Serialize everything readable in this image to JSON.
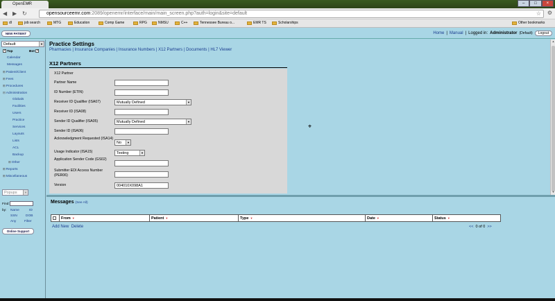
{
  "browser": {
    "tab_title": "OpenEMR",
    "tab_close": "×",
    "url_host": "opensourceemr.com",
    "url_path": ":2089/openemr/interface/main/main_screen.php?auth=login&site=default",
    "bookmarks": [
      "dl",
      "job search",
      "MTG",
      "Education",
      "Comp Game",
      "RPG",
      "NMSU",
      "C++",
      "Tennessee Bureau o...",
      "EMR TS",
      "Scholarships"
    ],
    "other_bookmarks": "Other bookmarks"
  },
  "header": {
    "new_patient": "NEW PATIENT",
    "home": "Home",
    "manual": "Manual",
    "logged_in_label": "Logged in:",
    "user": "Administrator",
    "site": "(Default)",
    "logout": "Logout",
    "separator": "|"
  },
  "leftnav": {
    "view_select": "Default",
    "top_label": "Top",
    "bot_label": "Bot",
    "items": {
      "calendar": "Calendar",
      "messages": "Messages",
      "patient_client": "Patient/Client",
      "fees": "Fees",
      "procedures": "Procedures",
      "administration": "Administration",
      "globals": "Globals",
      "facilities": "Facilities",
      "users": "Users",
      "practice": "Practice",
      "services": "Services",
      "layouts": "Layouts",
      "lists": "Lists",
      "acl": "ACL",
      "backup": "Backup",
      "other": "Other",
      "reports": "Reports",
      "miscellaneous": "Miscellaneous"
    },
    "popups_select": "Popups",
    "find_label": "Find:",
    "by_label": "by:",
    "find_name": "Name",
    "find_id": "ID",
    "find_ssn": "SSN",
    "find_dob": "DOB",
    "find_any": "Any",
    "find_filter": "Filter",
    "online_support": "Online Support"
  },
  "main": {
    "title": "Practice Settings",
    "links": [
      "Pharmacies",
      "Insurance Companies",
      "Insurance Numbers",
      "X12 Partners",
      "Documents",
      "HL7 Viewer"
    ],
    "section_title": "X12 Partners",
    "form": {
      "caption": "X12 Partner",
      "partner_name_label": "Partner Name",
      "partner_name_value": "",
      "etin_label": "ID Number (ETIN)",
      "etin_value": "",
      "isa07_label": "Receiver ID Qualifier (ISA07)",
      "isa07_value": "Mutually Defined",
      "isa08_label": "Receiver ID (ISA08)",
      "isa08_value": "",
      "isa05_label": "Sender ID Qualifier (ISA05)",
      "isa05_value": "Mutually Defined",
      "isa06_label": "Sender ID (ISA06)",
      "isa06_value": "",
      "isa14_label": "Acknowledgment Requested (ISA14)",
      "isa14_value": "No",
      "isa15_label": "Usage Indicator (ISA15)",
      "isa15_value": "Testing",
      "gs02_label": "Application Sender Code (GS02)",
      "gs02_value": "",
      "per06_label": "Submitter EDI Access Number (PER06)",
      "per06_value": "",
      "version_label": "Version",
      "version_value": "004010X098A1"
    }
  },
  "messages": {
    "title": "Messages",
    "see_all": "(See All)",
    "columns": [
      "From",
      "Patient",
      "Type",
      "Date",
      "Status"
    ],
    "add_new": "Add New",
    "delete": "Delete",
    "prev": "<<",
    "count": "0 of 0",
    "next": ">>"
  }
}
